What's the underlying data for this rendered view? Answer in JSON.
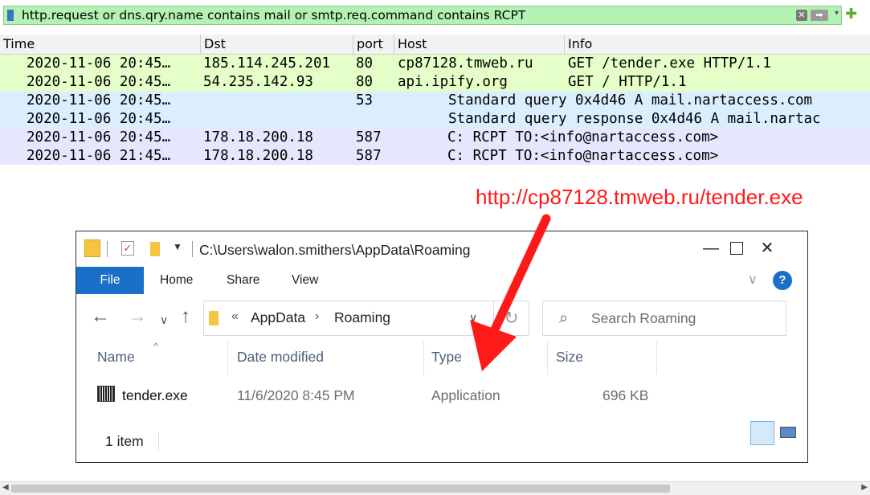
{
  "filter": {
    "expression": "http.request or dns.qry.name contains mail or smtp.req.command contains RCPT",
    "clear_icon": "clear-x-icon",
    "apply_icon": "arrow-right-icon",
    "add_icon": "plus-icon"
  },
  "packet_list": {
    "columns": [
      "Time",
      "Dst",
      "port",
      "Host",
      "Info"
    ],
    "rows": [
      {
        "time": "2020-11-06 20:45…",
        "dst": "185.114.245.201",
        "port": "80",
        "host": "cp87128.tmweb.ru",
        "info": "GET /tender.exe HTTP/1.1",
        "color": "#e4ffc7"
      },
      {
        "time": "2020-11-06 20:45…",
        "dst": "54.235.142.93",
        "port": "80",
        "host": "api.ipify.org",
        "info": "GET / HTTP/1.1",
        "color": "#e4ffc7"
      },
      {
        "time": "2020-11-06 20:45…",
        "dst": "",
        "port": "53",
        "host": "",
        "info": "Standard query 0x4d46 A mail.nartaccess.com",
        "color": "#daeeff"
      },
      {
        "time": "2020-11-06 20:45…",
        "dst": "",
        "port": "",
        "host": "",
        "info": "Standard query response 0x4d46 A mail.nartac",
        "color": "#daeeff"
      },
      {
        "time": "2020-11-06 20:45…",
        "dst": "178.18.200.18",
        "port": "587",
        "host": "",
        "info": "C: RCPT TO:<info@nartaccess.com>",
        "color": "#e7e6ff"
      },
      {
        "time": "2020-11-06 21:45…",
        "dst": "178.18.200.18",
        "port": "587",
        "host": "",
        "info": "C: RCPT TO:<info@nartaccess.com>",
        "color": "#e7e6ff"
      }
    ]
  },
  "annotation": {
    "text": "http://cp87128.tmweb.ru/tender.exe",
    "color": "#ff1a1a"
  },
  "explorer": {
    "title_path": "C:\\Users\\walon.smithers\\AppData\\Roaming",
    "ribbon_tabs": [
      "File",
      "Home",
      "Share",
      "View"
    ],
    "breadcrumb": [
      "AppData",
      "Roaming"
    ],
    "search_placeholder": "Search Roaming",
    "columns": [
      "Name",
      "Date modified",
      "Type",
      "Size"
    ],
    "files": [
      {
        "name": "tender.exe",
        "date_modified": "11/6/2020 8:45 PM",
        "type": "Application",
        "size": "696 KB",
        "icon": "exe-app-icon"
      }
    ],
    "status": "1 item",
    "accent": "#1a6fc8"
  }
}
